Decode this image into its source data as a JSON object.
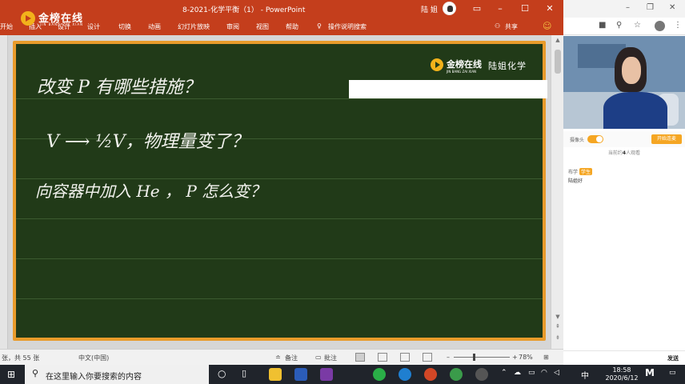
{
  "window": {
    "title": "8-2021-化学平衡（1） - PowerPoint",
    "user": "陆 姐",
    "brand": "金榜在线",
    "brand_sub": "JIN BANG ZAI XIAN",
    "share_label": "共享"
  },
  "ribbon": {
    "tabs": [
      "开始",
      "插入",
      "设计",
      "切换",
      "动画",
      "幻灯片放映",
      "审阅",
      "视图",
      "帮助",
      "操作说明搜索"
    ]
  },
  "slide": {
    "logo_name": "金榜在线",
    "logo_sub": "JIN BANG ZAI XIAN",
    "teacher": "陆姐化学",
    "lines": [
      "改变 P 有哪些措施？",
      "V ⟶ ½V，物理量变了？",
      "向容器中加入 He ， P 怎么变？"
    ]
  },
  "status": {
    "slide_count": "张，共 55 张",
    "language": "中文(中国)",
    "notes": "备注",
    "comments": "批注",
    "zoom": "78%",
    "zoom_fraction": 0.35
  },
  "live": {
    "camera_label": "摄像头",
    "start_button": "开始连麦",
    "viewers_prefix": "当前约",
    "viewers_count": "4",
    "viewers_suffix": "人观看",
    "chat": {
      "name": "布学",
      "tag": "学生",
      "text": "陆姐好"
    },
    "send_label": "发送"
  },
  "taskbar": {
    "search_placeholder": "在这里输入你要搜索的内容",
    "ime": "中",
    "time": "18:58",
    "date": "2020/6/12"
  },
  "colors": {
    "accent": "#c43e1c",
    "board": "#213a18",
    "frame": "#e89b2b",
    "highlight": "#f5a623"
  }
}
